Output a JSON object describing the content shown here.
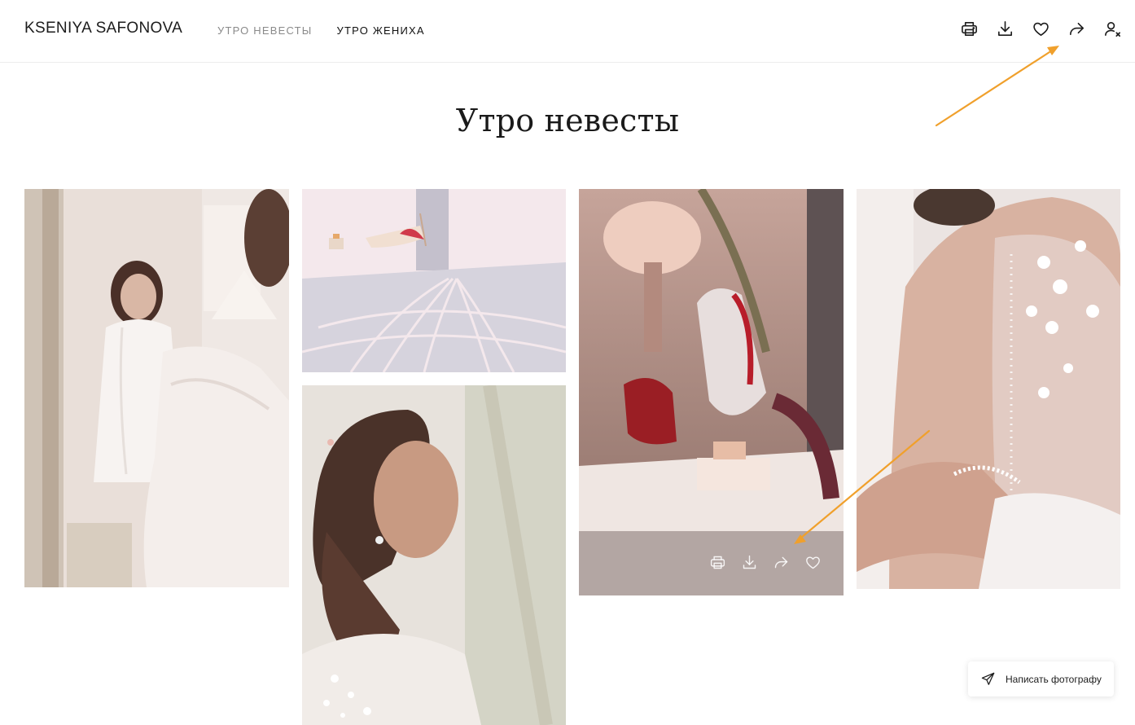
{
  "header": {
    "brand": "KSENIYA SAFONOVA",
    "nav": [
      {
        "label": "УТРО НЕВЕСТЫ",
        "state": "inactive"
      },
      {
        "label": "УТРО ЖЕНИХА",
        "state": "active"
      }
    ],
    "actions": [
      "printer-icon",
      "download-icon",
      "heart-icon",
      "share-icon",
      "user-icon"
    ]
  },
  "gallery": {
    "title": "Утро невесты",
    "photos": [
      {
        "name": "photo-bride-mirror"
      },
      {
        "name": "photo-shoes-floor"
      },
      {
        "name": "photo-bride-smiling"
      },
      {
        "name": "photo-shoes-perfume"
      },
      {
        "name": "photo-dress-back"
      }
    ],
    "hover_actions": [
      "printer-icon",
      "download-icon",
      "share-icon",
      "heart-icon"
    ]
  },
  "contact_button": {
    "label": "Написать фотографу",
    "icon": "paper-plane-icon"
  },
  "colors": {
    "annotation_arrow": "#f0a02c",
    "nav_inactive": "#8a8a8a",
    "text": "#1a1a1a"
  }
}
